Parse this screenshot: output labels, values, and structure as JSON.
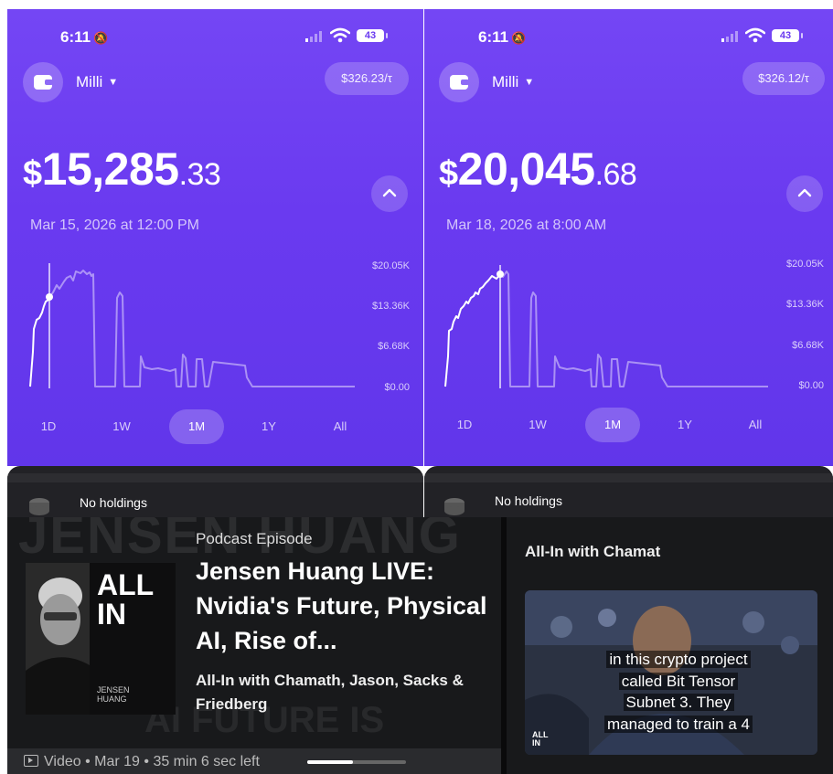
{
  "left_screen": {
    "status_time": "6:11",
    "battery": "43",
    "account_name": "Milli",
    "token_price": "$326.23/τ",
    "balance_currency": "$",
    "balance_whole": "15,285",
    "balance_cents": ".33",
    "date": "Mar 15, 2026 at 12:00 PM",
    "y_labels": [
      "$20.05K",
      "$13.36K",
      "$6.68K",
      "$0.00"
    ],
    "ranges": [
      "1D",
      "1W",
      "1M",
      "1Y",
      "All"
    ],
    "active_range": "1M",
    "holdings_text": "No holdings"
  },
  "right_screen": {
    "status_time": "6:11",
    "battery": "43",
    "account_name": "Milli",
    "token_price": "$326.12/τ",
    "balance_currency": "$",
    "balance_whole": "20,045",
    "balance_cents": ".68",
    "date": "Mar 18, 2026 at 8:00 AM",
    "y_labels": [
      "$20.05K",
      "$13.36K",
      "$6.68K",
      "$0.00"
    ],
    "ranges": [
      "1D",
      "1W",
      "1M",
      "1Y",
      "All"
    ],
    "active_range": "1M",
    "holdings_text": "No holdings"
  },
  "colors": {
    "accent": "#6a3af0",
    "panel_dark": "#18191b"
  },
  "podcast": {
    "background_text_top": "JENSEN HUANG",
    "background_text_bottom": "AI FUTURE IS",
    "cover_logo_line1": "ALL",
    "cover_logo_line2": "IN",
    "cover_name_line1": "JENSEN",
    "cover_name_line2": "HUANG",
    "type_label": "Podcast Episode",
    "title": "Jensen Huang LIVE: Nvidia's Future, Physical AI, Rise of...",
    "show": "All-In with Chamath, Jason, Sacks & Friedberg",
    "media_type": "Video",
    "date": "Mar 19",
    "time_left": "35 min 6 sec left",
    "progress": 0.46,
    "side_title": "All-In with Chamat",
    "caption_lines": [
      "in this crypto project",
      "called Bit Tensor",
      "Subnet 3. They",
      "managed to train a 4"
    ],
    "thumb_logo_line1": "ALL",
    "thumb_logo_line2": "IN"
  }
}
